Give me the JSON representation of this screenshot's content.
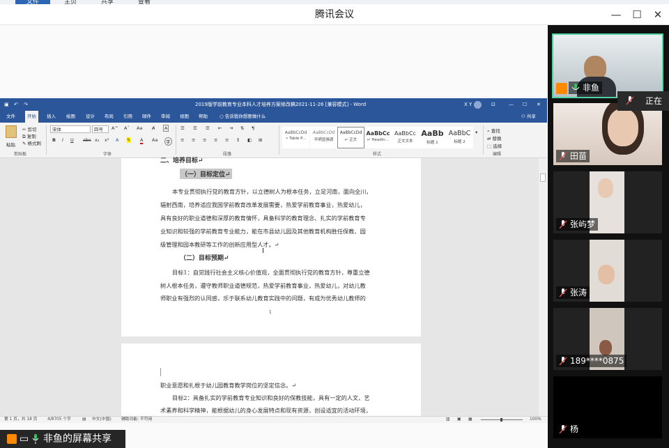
{
  "top_strip": {
    "items": [
      "文件",
      "主页",
      "共享",
      "查看"
    ]
  },
  "app": {
    "title": "腾讯会议"
  },
  "word": {
    "title": "2019版学前教育专业本科人才培养方案修改稿2021-11-26 [兼容模式] - Word",
    "user": "X Y",
    "tabs": [
      "文件",
      "开始",
      "插入",
      "绘图",
      "设计",
      "布局",
      "引用",
      "邮件",
      "审阅",
      "视图",
      "帮助",
      "告诉我你想要做什么"
    ],
    "share_label": "共享",
    "font_name": "宋体",
    "font_size": "四号",
    "clipboard": {
      "paste": "粘贴",
      "cut": "剪切",
      "copy": "复制",
      "format_painter": "格式刷",
      "label": "剪贴板"
    },
    "group_labels": {
      "font": "字体",
      "paragraph": "段落",
      "styles": "样式",
      "editing": "编辑"
    },
    "styles": [
      {
        "sample": "AaBbCcDd",
        "name": "• Table P..."
      },
      {
        "sample": "AaBbCcDd",
        "name": "不明显强调"
      },
      {
        "sample": "AaBbCcDd",
        "name": "↵ 正文"
      },
      {
        "sample": "AaBbCc",
        "name": "↵ Headin..."
      },
      {
        "sample": "AaBbCc",
        "name": "正文文本"
      },
      {
        "sample": "AaBb",
        "name": "标题 1"
      },
      {
        "sample": "AaBbC",
        "name": "标题 2"
      }
    ],
    "editing": {
      "find": "查找",
      "replace": "替换",
      "select": "选择"
    },
    "doc": {
      "heading_cut": "二、培养目标↵",
      "h1": "（一）目标定位↵",
      "p1": [
        "本专业贯彻执行党的教育方针，以立德树人为根本任务，立足河南，面向全川，",
        "辐射西南，培养适应我国学前教育改革发展需要，热爱学前教育事业，热爱幼儿，",
        "具有良好的职业道德和深厚的教育情怀，具备科学的教育理念、扎实的学前教育专",
        "业知识和较强的学前教育专业能力，能在市县幼儿园及其他教育机构胜任保教、园",
        "级管理和园本教研等工作的创新应用型人才。↵"
      ],
      "h2": "（二）目标预期↵",
      "p2": [
        "目标1：自觉践行社会主义核心价值观，全面贯彻执行党的教育方针，尊重立德",
        "树人根本任务，遵守教师职业道德规范，热爱学前教育事业，热爱幼儿，对幼儿教",
        "师职业有强烈的认同感，乐于联系幼儿教育实践中的问题，有成为优秀幼儿教师的"
      ],
      "page_no": "1",
      "p3": "职业意愿和扎根于幼儿园教育教学岗位的坚定信念。↵",
      "p4": [
        "目标2：具备扎实的学前教育专业知识和良好的保教技能，具有一定的人文、艺",
        "术素养和科学精神，能根据幼儿的身心发展特点和现有资源，创设适宜的活动环境，"
      ]
    },
    "status": {
      "page": "第 1 页，共 18 页",
      "words": "4/8705 个字",
      "lang": "中文(中国)",
      "accessibility": "辅助功能: 不可用",
      "zoom": "100%"
    }
  },
  "share_caption": "非鱼的屏幕共享",
  "participants": [
    {
      "name": "非鱼",
      "mic": "on"
    },
    {
      "name": "田苗",
      "mic": "off"
    },
    {
      "name": "张屿梦",
      "mic": "off"
    },
    {
      "name": "张涛",
      "mic": "off"
    },
    {
      "name": "189****0875",
      "mic": "off"
    },
    {
      "name": "杨",
      "mic": "off"
    }
  ],
  "speaking_label": "正在讲",
  "colors": {
    "word_blue": "#2b579a",
    "active_border": "#4fd1a0",
    "mic_on": "#33c15e",
    "mic_off": "#d9534f",
    "share_icon": "#ff8a00"
  }
}
